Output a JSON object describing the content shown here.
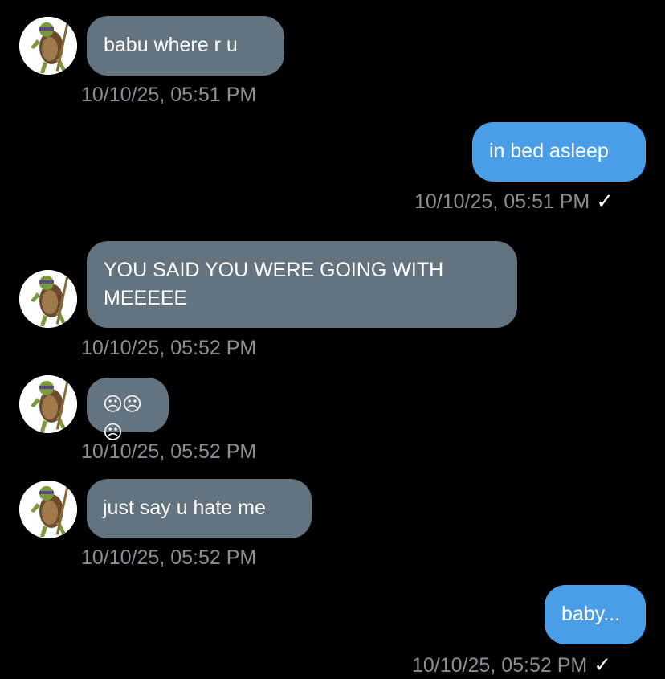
{
  "messages": [
    {
      "direction": "incoming",
      "text": "babu where r u",
      "time": "10/10/25, 05:51 PM",
      "avatar": "turtle-avatar"
    },
    {
      "direction": "outgoing",
      "text": "in bed asleep",
      "time": "10/10/25, 05:51 PM",
      "status": "✓"
    },
    {
      "direction": "incoming",
      "text": "YOU SAID YOU WERE GOING WITH\nMEEEEE",
      "time": "10/10/25, 05:52 PM",
      "avatar": "turtle-avatar"
    },
    {
      "direction": "incoming",
      "text": "☹☹☹",
      "time": "10/10/25, 05:52 PM",
      "avatar": "turtle-avatar"
    },
    {
      "direction": "incoming",
      "text": "just say u hate me",
      "time": "10/10/25, 05:52 PM",
      "avatar": "turtle-avatar"
    },
    {
      "direction": "outgoing",
      "text": "baby...",
      "time": "10/10/25, 05:52 PM",
      "status": "✓"
    }
  ],
  "colors": {
    "background": "#000000",
    "incoming_bubble": "#647380",
    "outgoing_bubble": "#4a9ee8",
    "timestamp": "#8a8f96",
    "text": "#ffffff"
  }
}
